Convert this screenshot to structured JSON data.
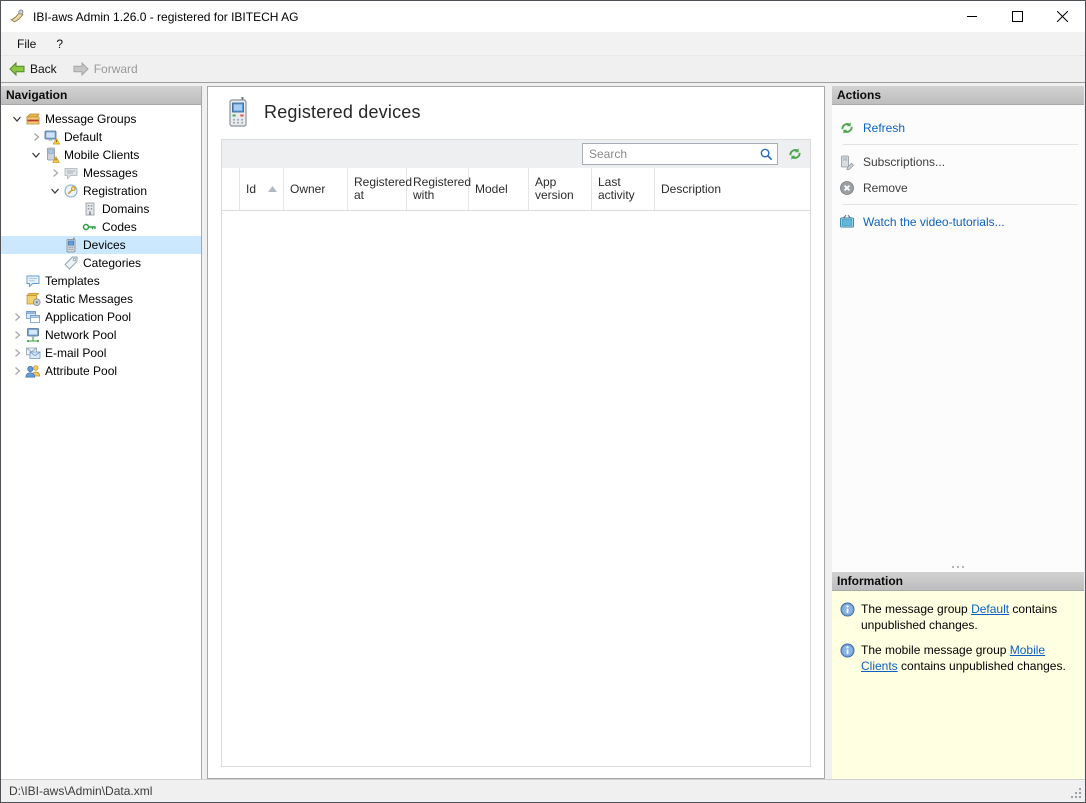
{
  "window": {
    "title": "IBI-aws Admin 1.26.0 - registered for IBITECH AG"
  },
  "menu": {
    "items": [
      "File",
      "?"
    ]
  },
  "toolbar": {
    "back_label": "Back",
    "forward_label": "Forward"
  },
  "navigation": {
    "header": "Navigation",
    "tree": [
      {
        "label": "Message Groups",
        "level": 0,
        "state": "expanded"
      },
      {
        "label": "Default",
        "level": 1,
        "state": "collapsed"
      },
      {
        "label": "Mobile Clients",
        "level": 1,
        "state": "expanded"
      },
      {
        "label": "Messages",
        "level": 2,
        "state": "collapsed"
      },
      {
        "label": "Registration",
        "level": 2,
        "state": "expanded"
      },
      {
        "label": "Domains",
        "level": 3,
        "state": "leaf"
      },
      {
        "label": "Codes",
        "level": 3,
        "state": "leaf"
      },
      {
        "label": "Devices",
        "level": 2,
        "state": "leaf",
        "selected": true
      },
      {
        "label": "Categories",
        "level": 2,
        "state": "leaf"
      },
      {
        "label": "Templates",
        "level": 0,
        "state": "leaf"
      },
      {
        "label": "Static Messages",
        "level": 0,
        "state": "leaf"
      },
      {
        "label": "Application Pool",
        "level": 0,
        "state": "collapsed"
      },
      {
        "label": "Network Pool",
        "level": 0,
        "state": "collapsed"
      },
      {
        "label": "E-mail Pool",
        "level": 0,
        "state": "collapsed"
      },
      {
        "label": "Attribute Pool",
        "level": 0,
        "state": "collapsed"
      }
    ]
  },
  "main": {
    "title": "Registered devices",
    "search_placeholder": "Search",
    "table": {
      "columns": [
        "",
        "Id",
        "Owner",
        "Registered at",
        "Registered with",
        "Model",
        "App version",
        "Last activity",
        "Description"
      ],
      "sort_column": "Id",
      "sort_direction": "asc",
      "rows": []
    }
  },
  "actions": {
    "header": "Actions",
    "items": [
      {
        "label": "Refresh",
        "enabled": true
      },
      {
        "label": "Subscriptions...",
        "enabled": false
      },
      {
        "label": "Remove",
        "enabled": false
      },
      {
        "label": "Watch the video-tutorials...",
        "enabled": true
      }
    ]
  },
  "information": {
    "header": "Information",
    "notes": [
      {
        "prefix": "The message group ",
        "link": "Default",
        "suffix": " contains unpublished changes."
      },
      {
        "prefix": "The mobile message group ",
        "link": "Mobile Clients",
        "suffix": " contains unpublished changes."
      }
    ]
  },
  "statusbar": {
    "path": "D:\\IBI-aws\\Admin\\Data.xml"
  },
  "colors": {
    "selection": "#cce8ff",
    "link": "#0b62c1",
    "info_panel_bg": "#ffffe1",
    "action_green": "#4ca64c",
    "warning_yellow": "#ffd24d"
  }
}
